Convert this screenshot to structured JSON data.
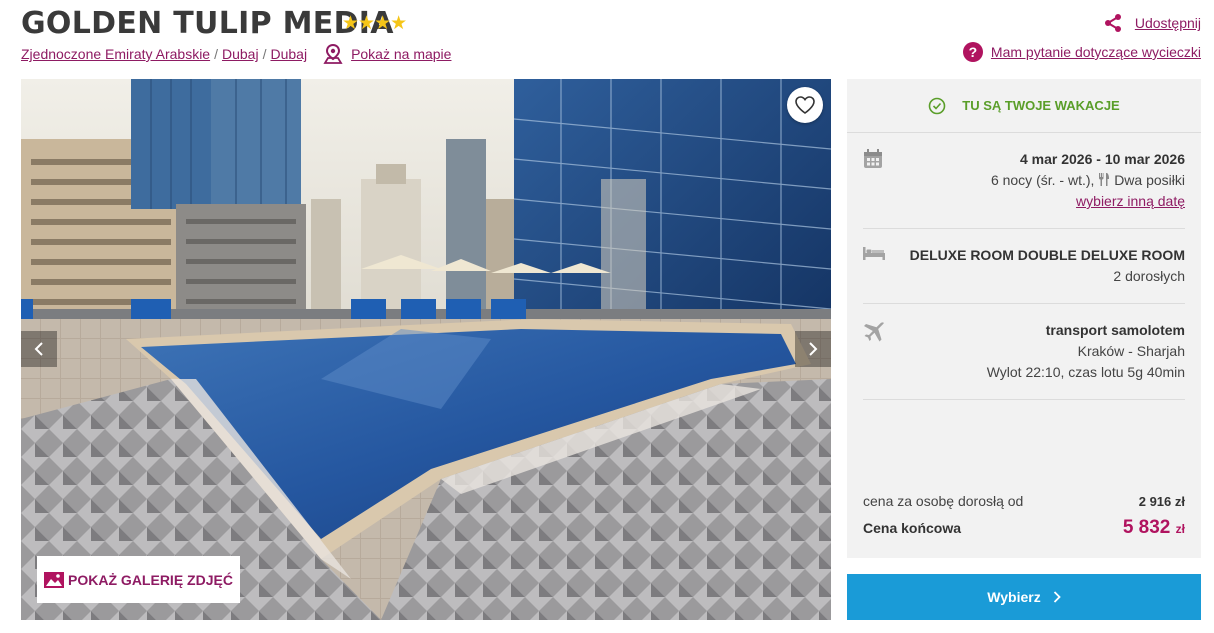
{
  "header": {
    "hotel_name": "GOLDEN TULIP MEDIA",
    "stars": "★★★★",
    "star_count": 4,
    "breadcrumb": [
      "Zjednoczone Emiraty Arabskie",
      "Dubaj",
      "Dubaj"
    ],
    "map_link": "Pokaż na mapie",
    "share_link": "Udostępnij",
    "question_link": "Mam pytanie dotyczące wycieczki",
    "question_icon": "?"
  },
  "gallery": {
    "show_gallery_label": "POKAŻ GALERIĘ ZDJĘĆ"
  },
  "panel": {
    "vacation_label": "TU SĄ TWOJE WAKACJE",
    "dates": "4 mar 2026 - 10 mar 2026",
    "nights": "6 nocy (śr. - wt.),",
    "meals": "Dwa posiłki",
    "change_date": "wybierz inną datę",
    "room": "DELUXE ROOM DOUBLE DELUXE ROOM",
    "guests": "2 dorosłych",
    "transport": "transport samolotem",
    "route": "Kraków - Sharjah",
    "flight": "Wylot 22:10, czas lotu 5g 40min",
    "price_label": "cena za osobę dorosłą od",
    "price_value": "2 916 zł",
    "final_label": "Cena końcowa",
    "final_value": "5 832",
    "final_currency": "zł"
  },
  "choose_button": "Wybierz",
  "colors": {
    "accent": "#8e1b63",
    "pink": "#b0135f",
    "green": "#5a9e29",
    "button_blue": "#1a9bd7",
    "star": "#f5c518"
  }
}
